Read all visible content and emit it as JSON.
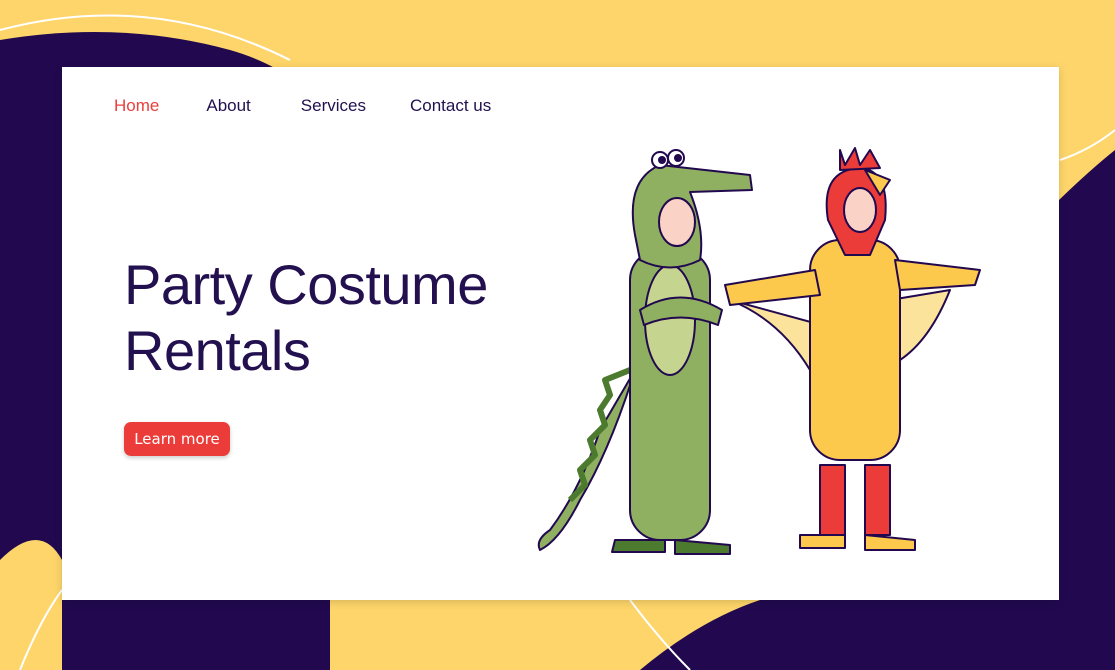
{
  "nav": {
    "items": [
      {
        "label": "Home",
        "active": true
      },
      {
        "label": "About"
      },
      {
        "label": "Services"
      },
      {
        "label": "Contact us"
      }
    ]
  },
  "hero": {
    "title_line1": "Party Costume",
    "title_line2": "Rentals",
    "cta_label": "Learn more"
  },
  "illustration": {
    "characters": [
      "crocodile-costume",
      "chicken-costume"
    ]
  },
  "colors": {
    "background_yellow": "#fdd56a",
    "background_purple": "#22094f",
    "accent_red": "#ec3c3a",
    "text_dark": "#22104f"
  }
}
